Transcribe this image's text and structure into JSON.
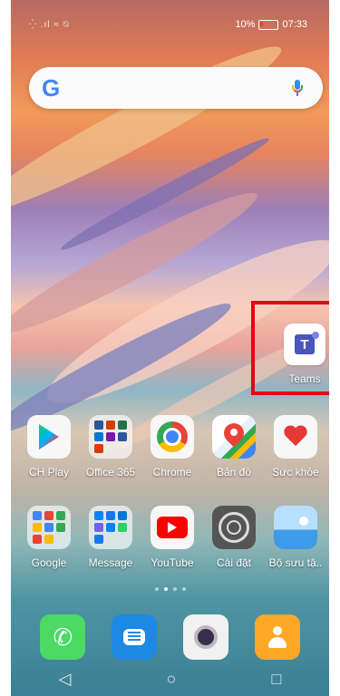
{
  "status_bar": {
    "left_text": "⁛ .ıl ≈ ⍉",
    "battery_percent": "10%",
    "time": "07:33"
  },
  "search_bar": {
    "logo_text": "G",
    "mic_icon": "mic-icon"
  },
  "featured_app": {
    "label": "Teams",
    "icon": "teams-icon",
    "highlight_color": "#e30613"
  },
  "apps_row_1": [
    {
      "label": "CH Play",
      "icon": "play-store-icon"
    },
    {
      "label": "Office 365",
      "icon": "folder-icon"
    },
    {
      "label": "Chrome",
      "icon": "chrome-icon"
    },
    {
      "label": "Bản đồ",
      "icon": "maps-icon"
    },
    {
      "label": "Sức khỏe",
      "icon": "health-icon"
    }
  ],
  "apps_row_2": [
    {
      "label": "Google",
      "icon": "folder-icon"
    },
    {
      "label": "Message",
      "icon": "folder-icon"
    },
    {
      "label": "YouTube",
      "icon": "youtube-icon"
    },
    {
      "label": "Cài đặt",
      "icon": "settings-icon"
    },
    {
      "label": "Bộ sưu tậ..",
      "icon": "gallery-icon"
    }
  ],
  "page_indicator": {
    "pages": 4,
    "active_index": 1
  },
  "dock": [
    {
      "icon": "phone-icon"
    },
    {
      "icon": "messages-icon"
    },
    {
      "icon": "camera-icon"
    },
    {
      "icon": "contacts-icon"
    }
  ],
  "nav_bar": {
    "back": "◁",
    "home": "○",
    "recent": "□"
  }
}
